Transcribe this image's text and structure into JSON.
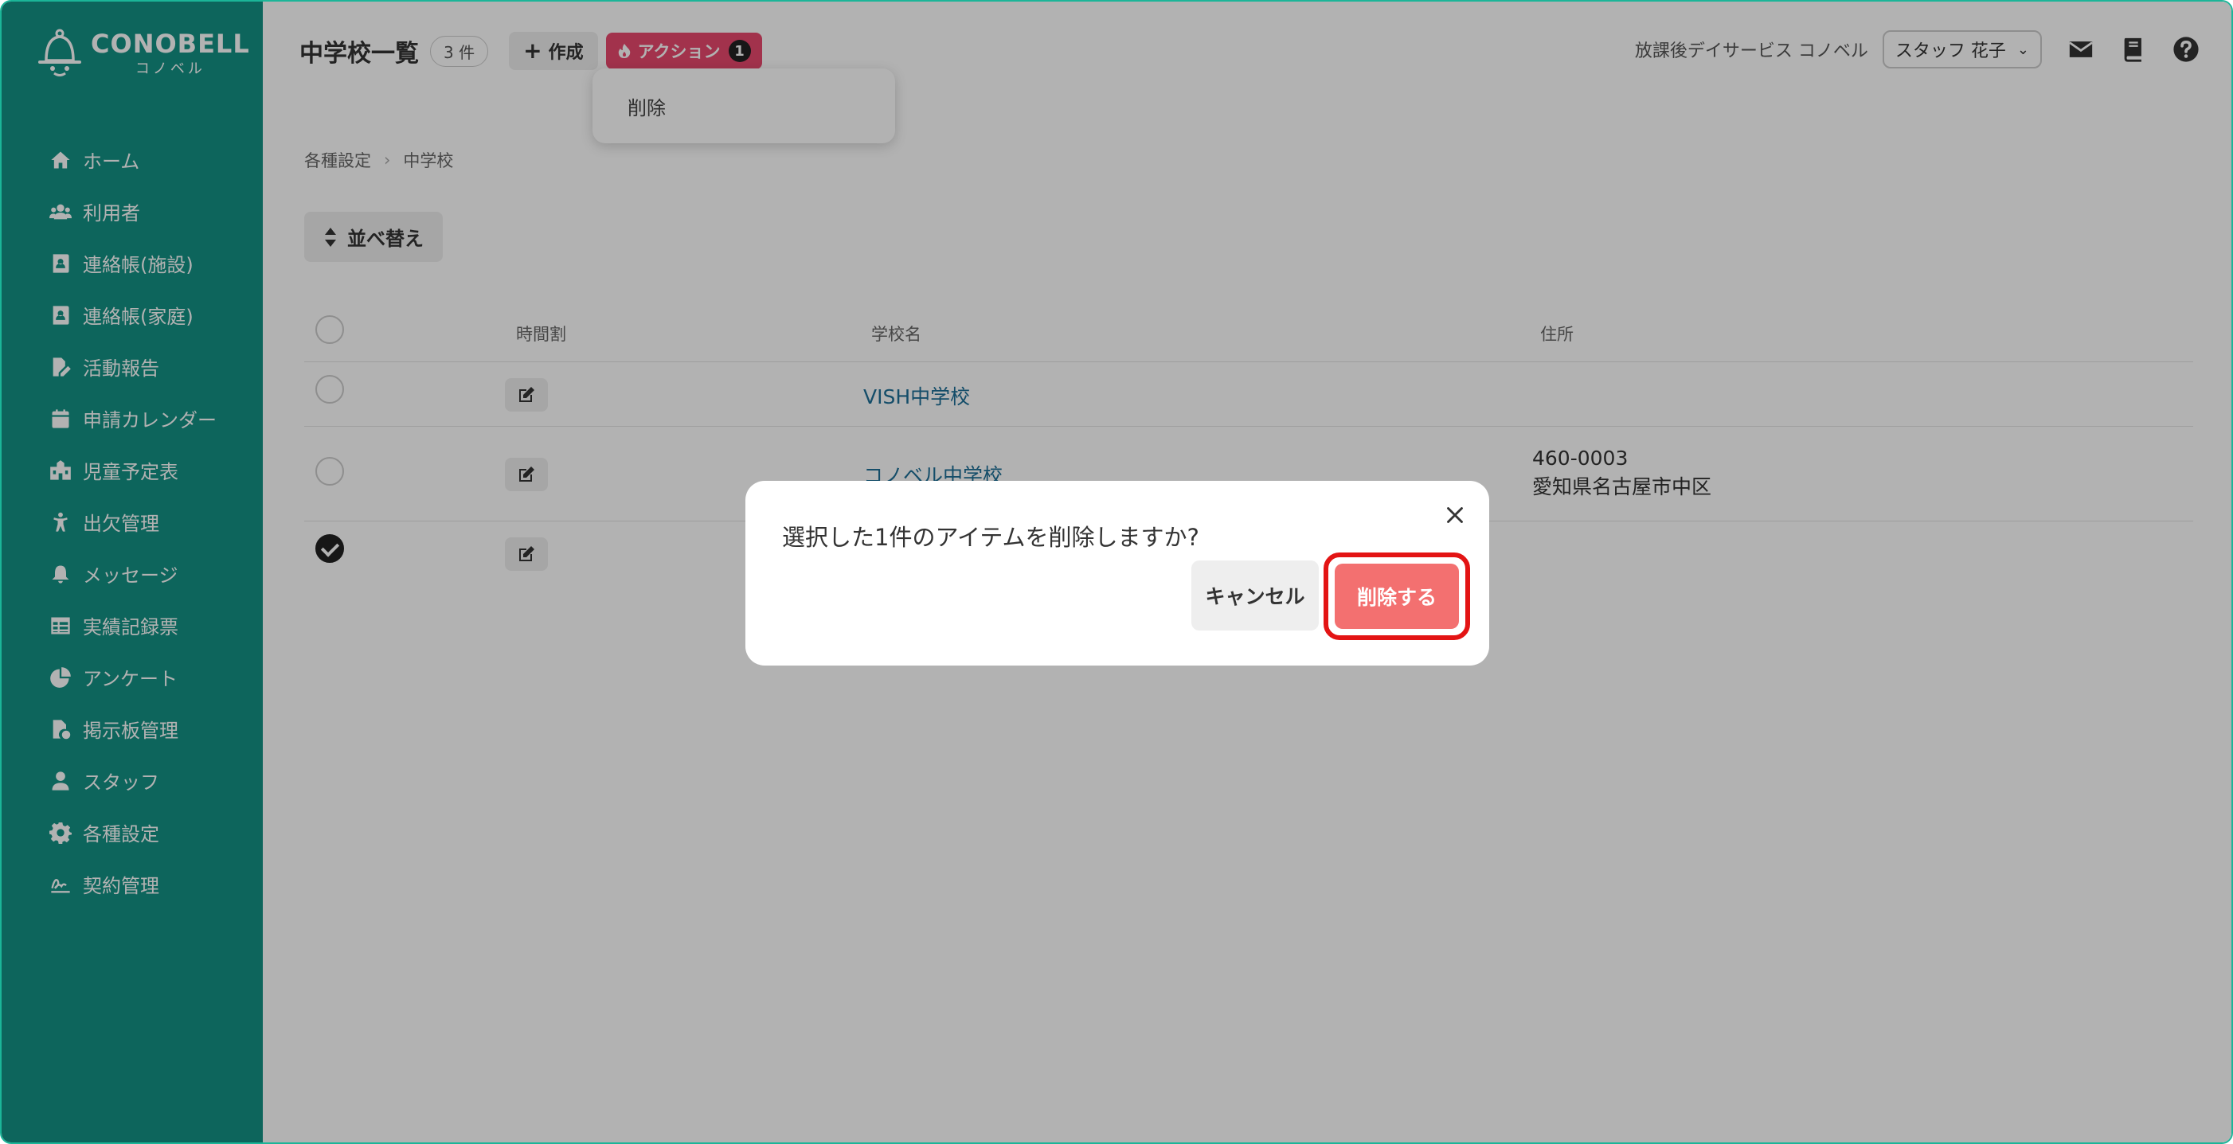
{
  "app": {
    "logo_text": "CONOBELL",
    "logo_sub": "コノベル"
  },
  "sidebar": {
    "items": [
      {
        "label": "ホーム",
        "icon": "home-icon"
      },
      {
        "label": "利用者",
        "icon": "users-icon"
      },
      {
        "label": "連絡帳(施設)",
        "icon": "contact-book-icon"
      },
      {
        "label": "連絡帳(家庭)",
        "icon": "contact-book-icon"
      },
      {
        "label": "活動報告",
        "icon": "report-edit-icon"
      },
      {
        "label": "申請カレンダー",
        "icon": "calendar-icon"
      },
      {
        "label": "児童予定表",
        "icon": "schedule-icon"
      },
      {
        "label": "出欠管理",
        "icon": "child-icon"
      },
      {
        "label": "メッセージ",
        "icon": "bell-icon"
      },
      {
        "label": "実績記録票",
        "icon": "table-icon"
      },
      {
        "label": "アンケート",
        "icon": "pie-chart-icon"
      },
      {
        "label": "掲示板管理",
        "icon": "file-settings-icon"
      },
      {
        "label": "スタッフ",
        "icon": "staff-icon"
      },
      {
        "label": "各種設定",
        "icon": "gear-icon"
      },
      {
        "label": "契約管理",
        "icon": "signature-icon"
      }
    ]
  },
  "header": {
    "title": "中学校一覧",
    "count": "3 件",
    "create_label": "作成",
    "action_label": "アクション",
    "action_count": "1",
    "action_menu_item": "削除",
    "facility": "放課後デイサービス コノベル",
    "user": "スタッフ 花子"
  },
  "breadcrumb": {
    "parent": "各種設定",
    "current": "中学校"
  },
  "sort_label": "並べ替え",
  "table": {
    "headers": {
      "timetable": "時間割",
      "school_name": "学校名",
      "address": "住所"
    },
    "rows": [
      {
        "school": "VISH中学校",
        "zip": "",
        "address": "",
        "checked": false
      },
      {
        "school": "コノベル中学校",
        "zip": "460-0003",
        "address": "愛知県名古屋市中区",
        "checked": false
      },
      {
        "school": "",
        "zip": "",
        "address": "",
        "checked": true
      }
    ]
  },
  "modal": {
    "message": "選択した1件のアイテムを削除しますか?",
    "cancel_label": "キャンセル",
    "delete_label": "削除する"
  },
  "colors": {
    "sidebar": "#139184",
    "action": "#e8486d",
    "delete": "#f37070",
    "highlight": "#e31414",
    "link": "#1e6f97"
  }
}
